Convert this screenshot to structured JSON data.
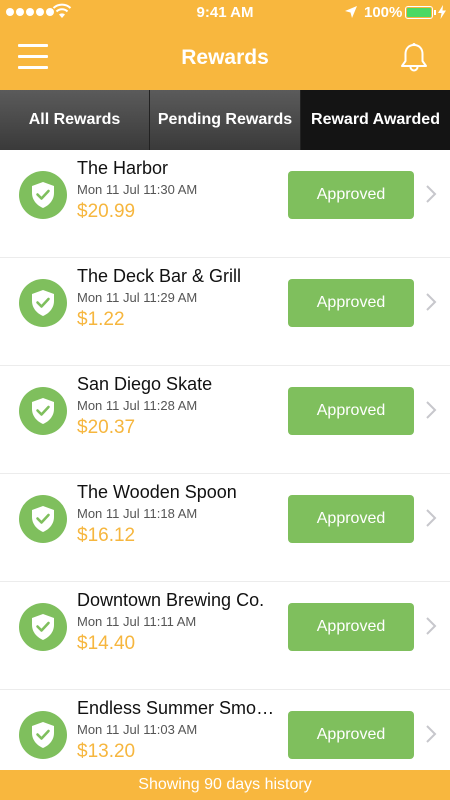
{
  "status_bar": {
    "time": "9:41 AM",
    "battery": "100%",
    "icons": [
      "signal-dots-icon",
      "wifi-icon",
      "location-arrow-icon",
      "battery-icon",
      "charging-bolt-icon"
    ]
  },
  "header": {
    "title": "Rewards",
    "menu_icon": "hamburger-menu-icon",
    "bell_icon": "bell-icon"
  },
  "tabs": [
    {
      "label": "All Rewards",
      "selected": false
    },
    {
      "label": "Pending Rewards",
      "selected": false
    },
    {
      "label": "Reward Awarded",
      "selected": true
    }
  ],
  "rewards": [
    {
      "merchant": "The Harbor",
      "date": "Mon 11 Jul 11:30 AM",
      "amount": "$20.99",
      "status": "Approved"
    },
    {
      "merchant": "The Deck Bar & Grill",
      "date": "Mon 11 Jul 11:29 AM",
      "amount": "$1.22",
      "status": "Approved"
    },
    {
      "merchant": "San Diego Skate",
      "date": "Mon 11 Jul 11:28 AM",
      "amount": "$20.37",
      "status": "Approved"
    },
    {
      "merchant": "The Wooden Spoon",
      "date": "Mon 11 Jul 11:18 AM",
      "amount": "$16.12",
      "status": "Approved"
    },
    {
      "merchant": "Downtown Brewing Co.",
      "date": "Mon 11 Jul 11:11 AM",
      "amount": "$14.40",
      "status": "Approved"
    },
    {
      "merchant": "Endless Summer Smoo…",
      "date": "Mon 11 Jul 11:03 AM",
      "amount": "$13.20",
      "status": "Approved"
    }
  ],
  "footer": {
    "text": "Showing 90 days history"
  },
  "colors": {
    "brand_orange": "#f8b73e",
    "approved_green": "#7fbf5d",
    "amount_color": "#f6b63e",
    "tab_selected": "#141414"
  }
}
